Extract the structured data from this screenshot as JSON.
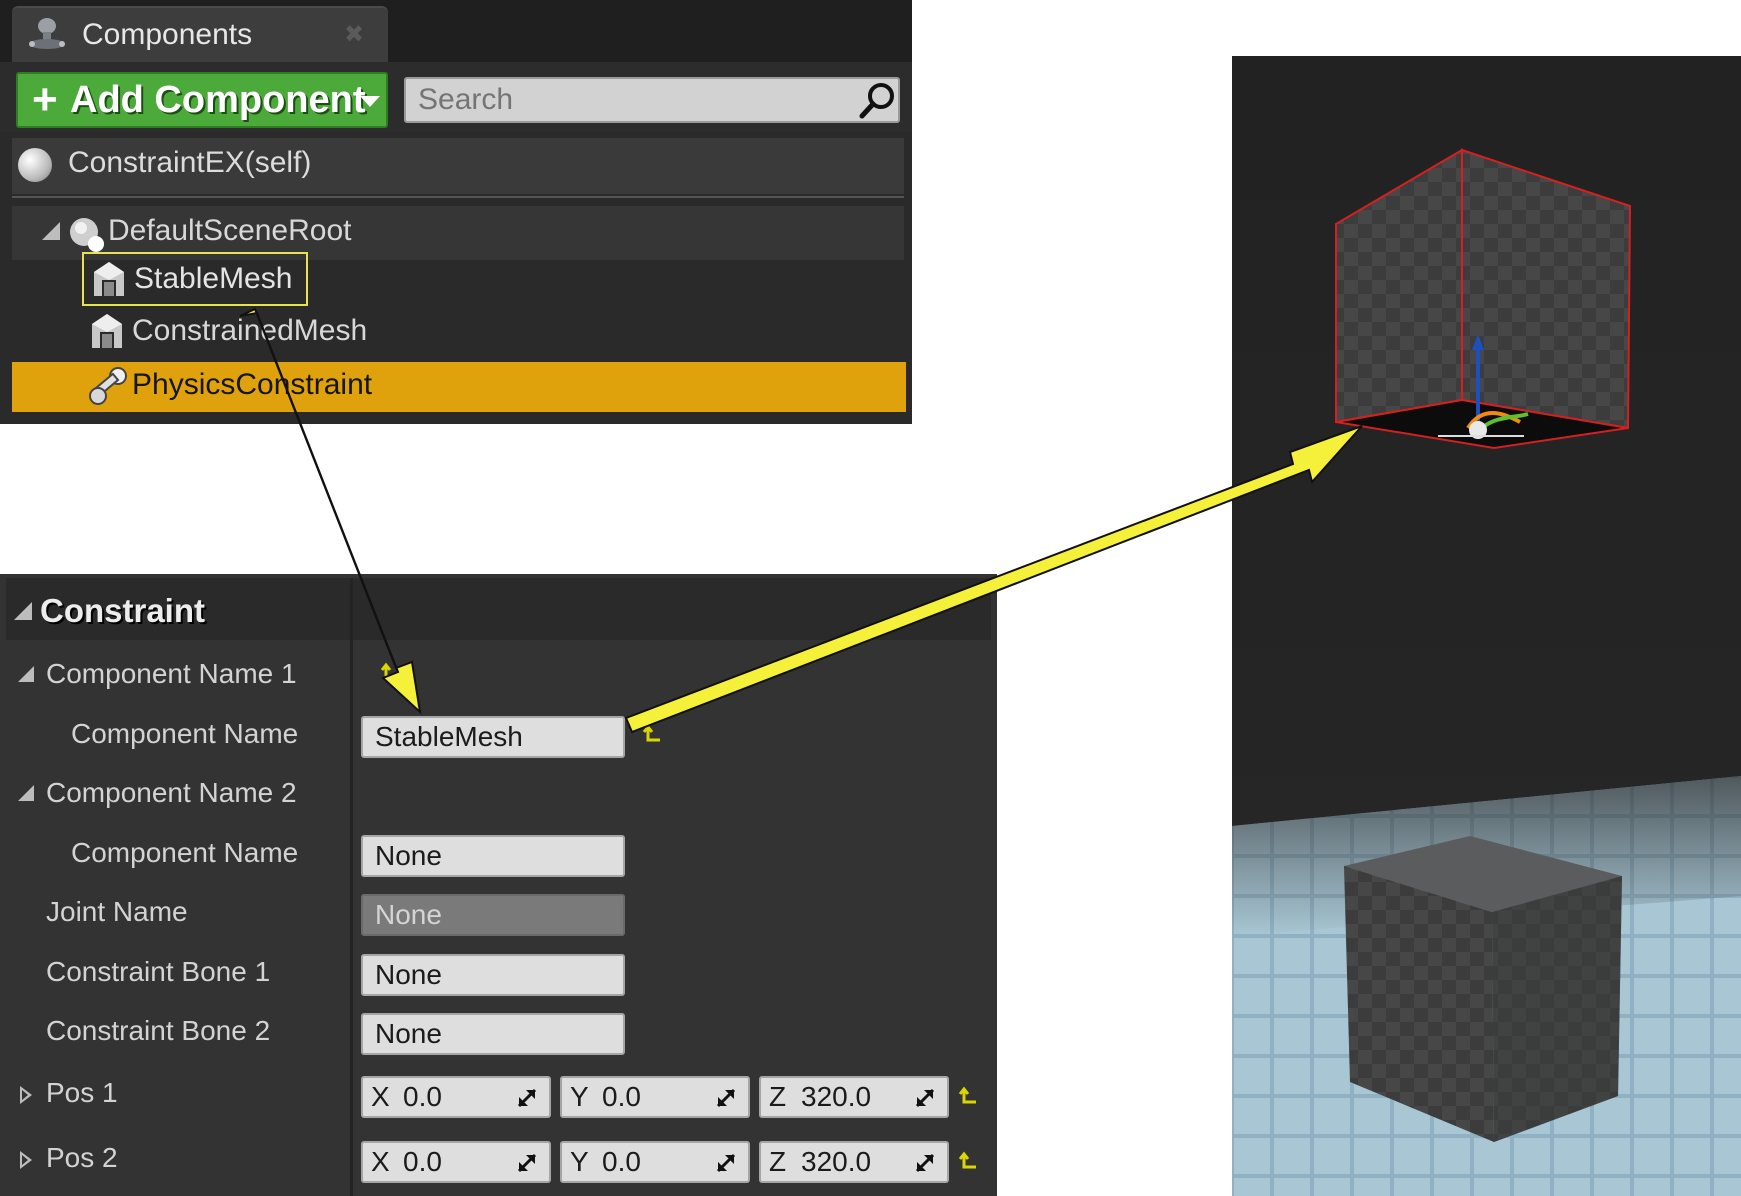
{
  "components_panel": {
    "tab_title": "Components",
    "add_button_label": "Add Component",
    "search_placeholder": "Search",
    "self_item": "ConstraintEX(self)",
    "tree": {
      "root": "DefaultSceneRoot",
      "children": [
        "StableMesh",
        "ConstrainedMesh",
        "PhysicsConstraint"
      ],
      "selected": "PhysicsConstraint",
      "highlighted": "StableMesh"
    },
    "colors": {
      "add_button": "#4caa3a",
      "selected_row": "#e0a20c",
      "highlight_box": "#e7e34a"
    }
  },
  "details": {
    "section_title": "Constraint",
    "component_name_1": {
      "label": "Component Name 1",
      "field_label": "Component Name",
      "value": "StableMesh"
    },
    "component_name_2": {
      "label": "Component Name 2",
      "field_label": "Component Name",
      "value": "None"
    },
    "joint_name": {
      "label": "Joint Name",
      "value": "None"
    },
    "constraint_bone_1": {
      "label": "Constraint Bone 1",
      "value": "None"
    },
    "constraint_bone_2": {
      "label": "Constraint Bone 2",
      "value": "None"
    },
    "pos1": {
      "label": "Pos 1",
      "x_axis": "X",
      "x": "0.0",
      "y_axis": "Y",
      "y": "0.0",
      "z_axis": "Z",
      "z": "320.0"
    },
    "pos2": {
      "label": "Pos 2",
      "x_axis": "X",
      "x": "0.0",
      "y_axis": "Y",
      "y": "0.0",
      "z_axis": "Z",
      "z": "320.0"
    }
  },
  "annotation": {
    "arrow_color": "#f5f03a"
  }
}
